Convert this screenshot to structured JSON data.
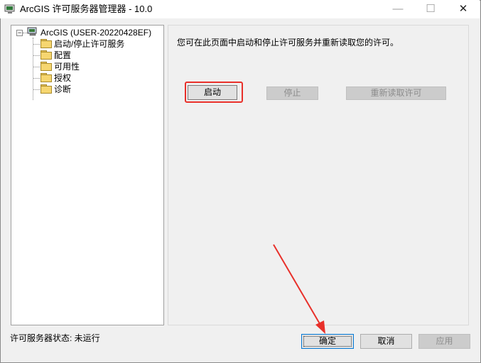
{
  "window": {
    "title": "ArcGIS 许可服务器管理器 - 10.0",
    "min_glyph": "—",
    "max_glyph": "☐",
    "close_glyph": "✕"
  },
  "tree": {
    "root": "ArcGIS (USER-20220428EF)",
    "expander_glyph": "−",
    "items": [
      {
        "label": "启动/停止许可服务"
      },
      {
        "label": "配置"
      },
      {
        "label": "可用性"
      },
      {
        "label": "授权"
      },
      {
        "label": "诊断"
      }
    ]
  },
  "panel": {
    "description": "您可在此页面中启动和停止许可服务并重新读取您的许可。",
    "start_label": "启动",
    "stop_label": "停止",
    "reread_label": "重新读取许可"
  },
  "footer": {
    "status": "许可服务器状态: 未运行",
    "ok_label": "确定",
    "cancel_label": "取消",
    "apply_label": "应用"
  },
  "colors": {
    "highlight": "#e8302a",
    "focus": "#0078d7"
  },
  "icons": [
    "app-icon",
    "computer-icon",
    "folder-icon"
  ]
}
